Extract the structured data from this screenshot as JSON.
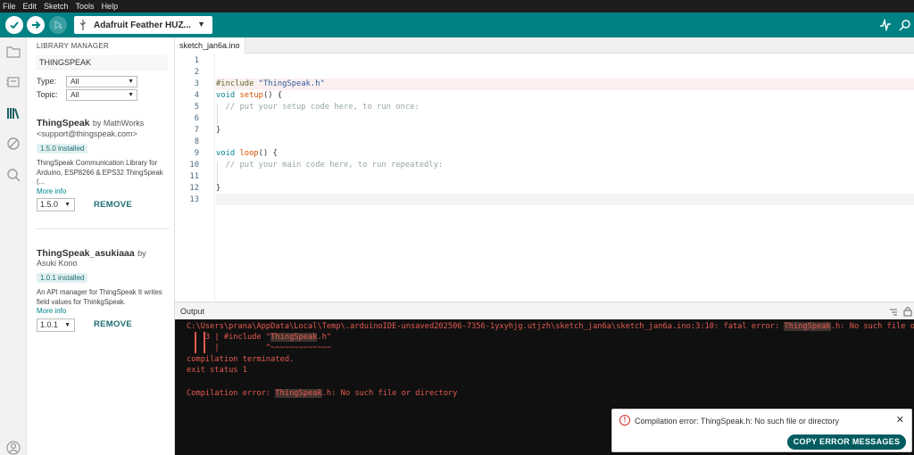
{
  "menu": [
    "File",
    "Edit",
    "Sketch",
    "Tools",
    "Help"
  ],
  "toolbar": {
    "board_name": "Adafruit Feather HUZ...",
    "colors": {
      "accent": "#008184",
      "dark": "#005c5f"
    }
  },
  "library": {
    "title": "LIBRARY MANAGER",
    "search_value": "THINGSPEAK",
    "type_label": "Type:",
    "type_value": "All",
    "topic_label": "Topic:",
    "topic_value": "All",
    "items": [
      {
        "name": "ThingSpeak",
        "by": "by MathWorks",
        "author_line": "<support@thingspeak.com>",
        "installed": "1.5.0 installed",
        "description": "ThingSpeak Communication Library for Arduino, ESP8266 & EPS32 ThingSpeak (...",
        "more": "More info",
        "version": "1.5.0",
        "action": "REMOVE"
      },
      {
        "name": "ThingSpeak_asukiaaa",
        "by": "by",
        "author_line": "Asuki Kono",
        "installed": "1.0.1 installed",
        "description": "An API manager for ThingSpeak It writes field values for ThinkgSpeak.",
        "more": "More info",
        "version": "1.0.1",
        "action": "REMOVE"
      }
    ]
  },
  "editor": {
    "tab": "sketch_jan6a.ino",
    "lines": [
      "1",
      "2",
      "3",
      "4",
      "5",
      "6",
      "7",
      "8",
      "9",
      "10",
      "11",
      "12",
      "13"
    ],
    "code": {
      "l3_pp": "#include",
      "l3_str": "\"ThingSpeak.h\"",
      "l4_kw": "void",
      "l4_fn": "setup",
      "l4_rest": "() {",
      "l5_cm": "  // put your setup code here, to run once:",
      "l7": "}",
      "l9_kw": "void",
      "l9_fn": "loop",
      "l9_rest": "() {",
      "l10_cm": "  // put your main code here, to run repeatedly:",
      "l12": "}"
    }
  },
  "output": {
    "title": "Output",
    "err_path": "C:\\Users\\prana\\AppData\\Local\\Temp\\.arduinoIDE-unsaved202506-7356-1yxyhjg.utjzh\\sketch_jan6a\\sketch_jan6a.ino:3:10: fatal error: ",
    "err_mark": "ThingSpeak",
    "err_tail": ".h: No such file or directory",
    "src_prefix": "    3 | #include \"",
    "src_mark": "ThingSpeak",
    "src_tail": ".h\"",
    "caret_line": "      |          ^~~~~~~~~~~~~~",
    "terminated": "compilation terminated.",
    "exit": "exit status 1",
    "summary_prefix": "Compilation error: ",
    "summary_mark": "ThingSpeak",
    "summary_tail": ".h: No such file or directory"
  },
  "toast": {
    "message": "Compilation error: ThingSpeak.h: No such file or directory",
    "button": "COPY ERROR MESSAGES",
    "close": "✕",
    "error_glyph": "!"
  }
}
